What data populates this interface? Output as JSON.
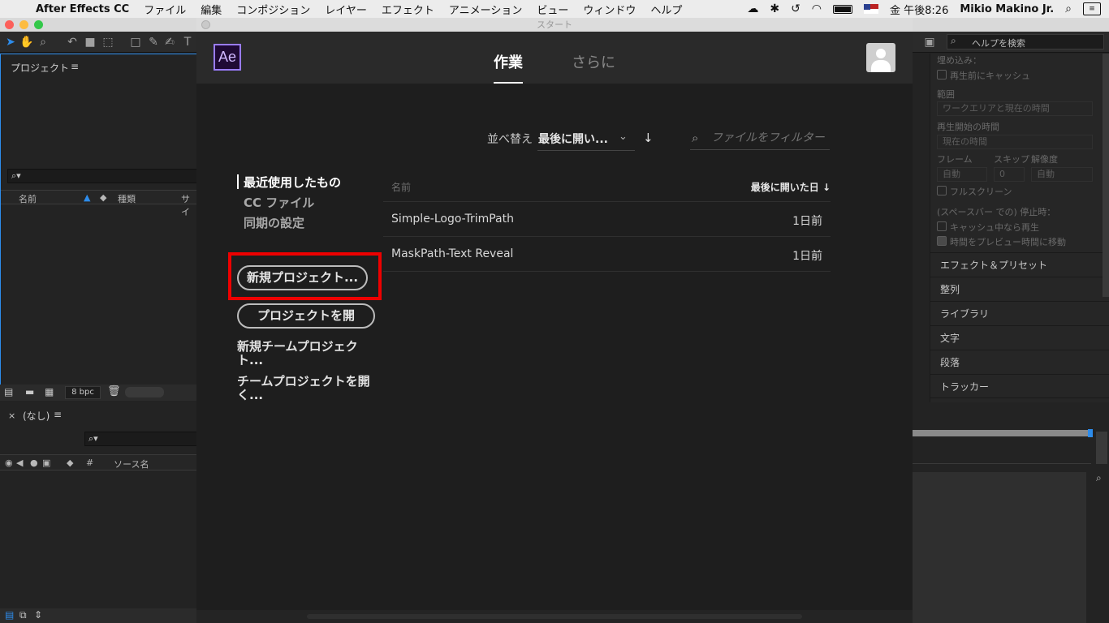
{
  "menubar": {
    "app_name": "After Effects CC",
    "menus": [
      "ファイル",
      "編集",
      "コンポジション",
      "レイヤー",
      "エフェクト",
      "アニメーション",
      "ビュー",
      "ウィンドウ",
      "ヘルプ"
    ],
    "clock": "金 午後8:26",
    "user": "Mikio Makino Jr."
  },
  "project_panel": {
    "title": "プロジェクト",
    "columns": [
      "名前",
      "種類",
      "サイ"
    ],
    "bpc": "8 bpc"
  },
  "timeline_panel": {
    "comp_name": "(なし)",
    "columns": [
      "#",
      "ソース名"
    ]
  },
  "right_panel": {
    "help_search_placeholder": "ヘルプを検索",
    "embed_label": "埋め込み：",
    "cache_before_play": "再生前にキャッシュ",
    "range_label": "範囲",
    "range_value": "ワークエリアと現在の時間",
    "play_from_label": "再生開始の時間",
    "play_from_value": "現在の時間",
    "frame_label": "フレーム",
    "skip_label": "スキップ",
    "resolution_label": "解像度",
    "frame_value": "自動",
    "skip_value": "0",
    "resolution_value": "自動",
    "fullscreen": "フルスクリーン",
    "on_stop_label": "(スペースバー での) 停止時：",
    "play_if_cached": "キャッシュ中なら再生",
    "move_time": "時間をプレビュー時間に移動",
    "sections": [
      "エフェクト＆プリセット",
      "整列",
      "ライブラリ",
      "文字",
      "段落",
      "トラッカー"
    ]
  },
  "start_dialog": {
    "window_title": "スタート",
    "logo_text": "Ae",
    "tabs": [
      "作業",
      "さらに"
    ],
    "sort_label": "並べ替え",
    "sort_value": "最後に開い...",
    "filter_placeholder": "ファイルをフィルター",
    "nav": [
      "最近使用したもの",
      "CC ファイル",
      "同期の設定"
    ],
    "new_project_button": "新規プロジェクト...",
    "open_project_button": "プロジェクトを開",
    "new_team_project": "新規チームプロジェクト...",
    "open_team_project": "チームプロジェクトを開く...",
    "list_header_name": "名前",
    "list_header_date": "最後に開いた日 ↓",
    "files": [
      {
        "name": "Simple-Logo-TrimPath",
        "date": "1日前"
      },
      {
        "name": "MaskPath-Text Reveal",
        "date": "1日前"
      }
    ]
  },
  "colors": {
    "highlight_box": "#ee0000",
    "ae_logo_border": "#9a7cff",
    "panel_focus": "#2d8ceb"
  }
}
